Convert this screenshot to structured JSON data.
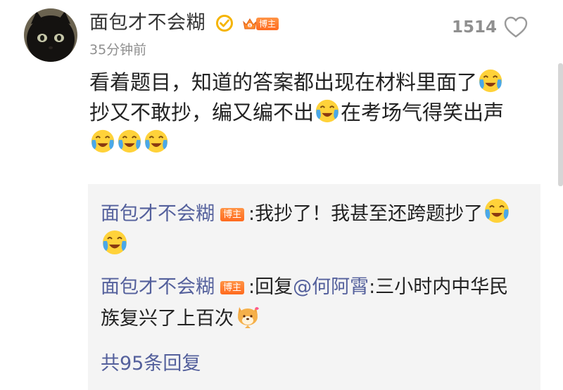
{
  "post": {
    "author": "面包才不会糊",
    "owner_tag": "博主",
    "time": "35分钟前",
    "like_count": "1514",
    "content": {
      "line1": "看着题目，知道的答案都出现在材料里面了",
      "line2a": "抄又不敢抄，编又编不出",
      "line2b": "在考场气得笑出声"
    }
  },
  "replies": [
    {
      "user": "面包才不会糊",
      "tag": "博主",
      "text": ":我抄了！我甚至还跨题抄了"
    },
    {
      "user": "面包才不会糊",
      "tag": "博主",
      "prefix": ":回复",
      "mention": "@何阿霄",
      "text": ":三小时内中华民族复兴了上百次"
    }
  ],
  "more_replies": "共95条回复",
  "icons": {
    "avatar": "black-cat-avatar",
    "verified": "verified-badge-icon",
    "crown": "crown-icon",
    "like": "heart-outline-icon",
    "emoji_laugh_cry": "laugh-cry-emoji",
    "emoji_dog": "shiba-dog-emoji"
  },
  "colors": {
    "accent_link": "#54609c",
    "tag_orange": "#ff7a2a",
    "verified_gold": "#f5b400",
    "muted": "#8f8f8f",
    "reply_bg": "#f4f4f4"
  }
}
